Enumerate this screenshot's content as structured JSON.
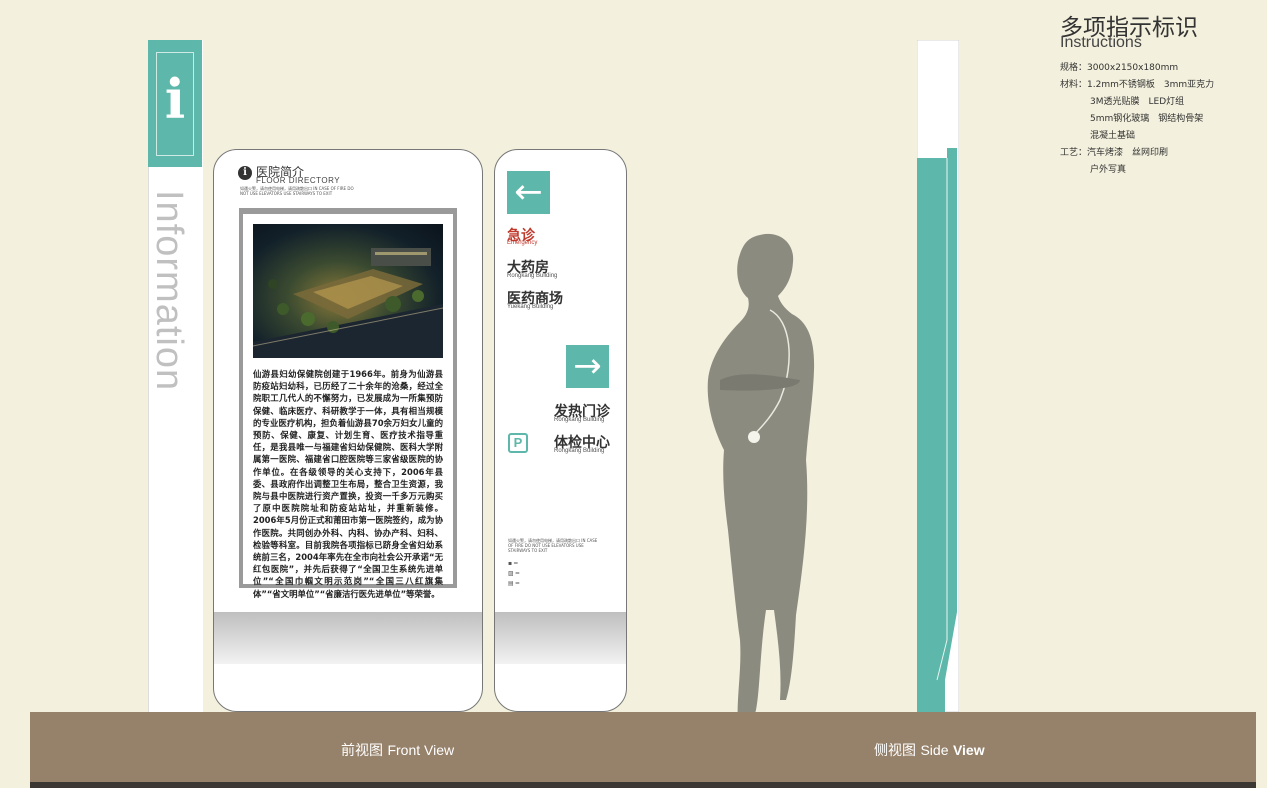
{
  "title": {
    "cn": "多项指示标识",
    "en": "Instructions"
  },
  "specs": {
    "size": "规格：3000x2150x180mm",
    "material_1": "材料：1.2mm不锈钢板　3mm亚克力",
    "material_2": "3M透光贴膜　LED灯组",
    "material_3": "5mm钢化玻璃　钢结构骨架",
    "material_4": "混凝土基础",
    "craft_1": "工艺：汽车烤漆　丝网印刷",
    "craft_2": "户外写真"
  },
  "pylon": {
    "icon_letter": "i",
    "vertical_word": "Information"
  },
  "directory": {
    "icon": "info-icon",
    "title": "医院简介",
    "subtitle": "FLOOR DIRECTORY",
    "note": "如遇火警，请勿使用电梯，请用疏散出口 IN CASE OF FIRE DO NOT USE ELEVATORS USE STAIRWAYS TO EXIT",
    "intro": "仙游县妇幼保健院创建于1966年。前身为仙游县防疫站妇幼科，已历经了二十余年的沧桑，经过全院职工几代人的不懈努力，已发展成为一所集预防保健、临床医疗、科研教学于一体，具有相当规模的专业医疗机构，担负着仙游县70余万妇女儿童的预防、保健、康复、计划生育、医疗技术指导重任，是我县唯一与福建省妇幼保健院、医科大学附属第一医院、福建省口腔医院等三家省级医院的协作单位。在各级领导的关心支持下，2006年县委、县政府作出调整卫生布局，整合卫生资源，我院与县中医院进行资产置换，投资一千多万元购买了原中医院院址和防疫站站址，并重新装修。2006年5月份正式和莆田市第一医院签约，成为协作医院。共同创办外科、内科、协办产科、妇科、检验等科室。目前我院各项指标已跻身全省妇幼系统前三名，2004年率先在全市向社会公开承诺“无红包医院”，并先后获得了“全国卫生系统先进单位”“全国巾帼文明示范岗”“全国三八红旗集体”“省文明单位”“省廉洁行医先进单位”等荣誉。"
  },
  "wayfinding": {
    "left_arrow": "←",
    "right_arrow": "→",
    "emergency": {
      "cn": "急诊",
      "en": "Emergency",
      "color": "#c0392b"
    },
    "pharmacy": {
      "cn": "大药房",
      "en": "Rongkang Building"
    },
    "drugstore": {
      "cn": "医药商场",
      "en": "Yuekang Building"
    },
    "fever": {
      "cn": "发热门诊",
      "en": "Rongkang Building"
    },
    "checkup": {
      "cn": "体检中心",
      "en": "Rongkang Building"
    },
    "parking": "P",
    "note": "如遇火警，请勿使用电梯，请用疏散出口 IN CASE OF FIRE DO NOT USE ELEVATORS USE STAIRWAYS TO EXIT"
  },
  "views": {
    "front": {
      "cn": "前视图",
      "en": "Front View"
    },
    "side": {
      "cn": "侧视图",
      "en": "Side",
      "en2": "View"
    }
  },
  "colors": {
    "accent": "#5db7aa",
    "background": "#f3f0dd",
    "ground": "#96816a",
    "silhouette": "#8b8b80"
  }
}
